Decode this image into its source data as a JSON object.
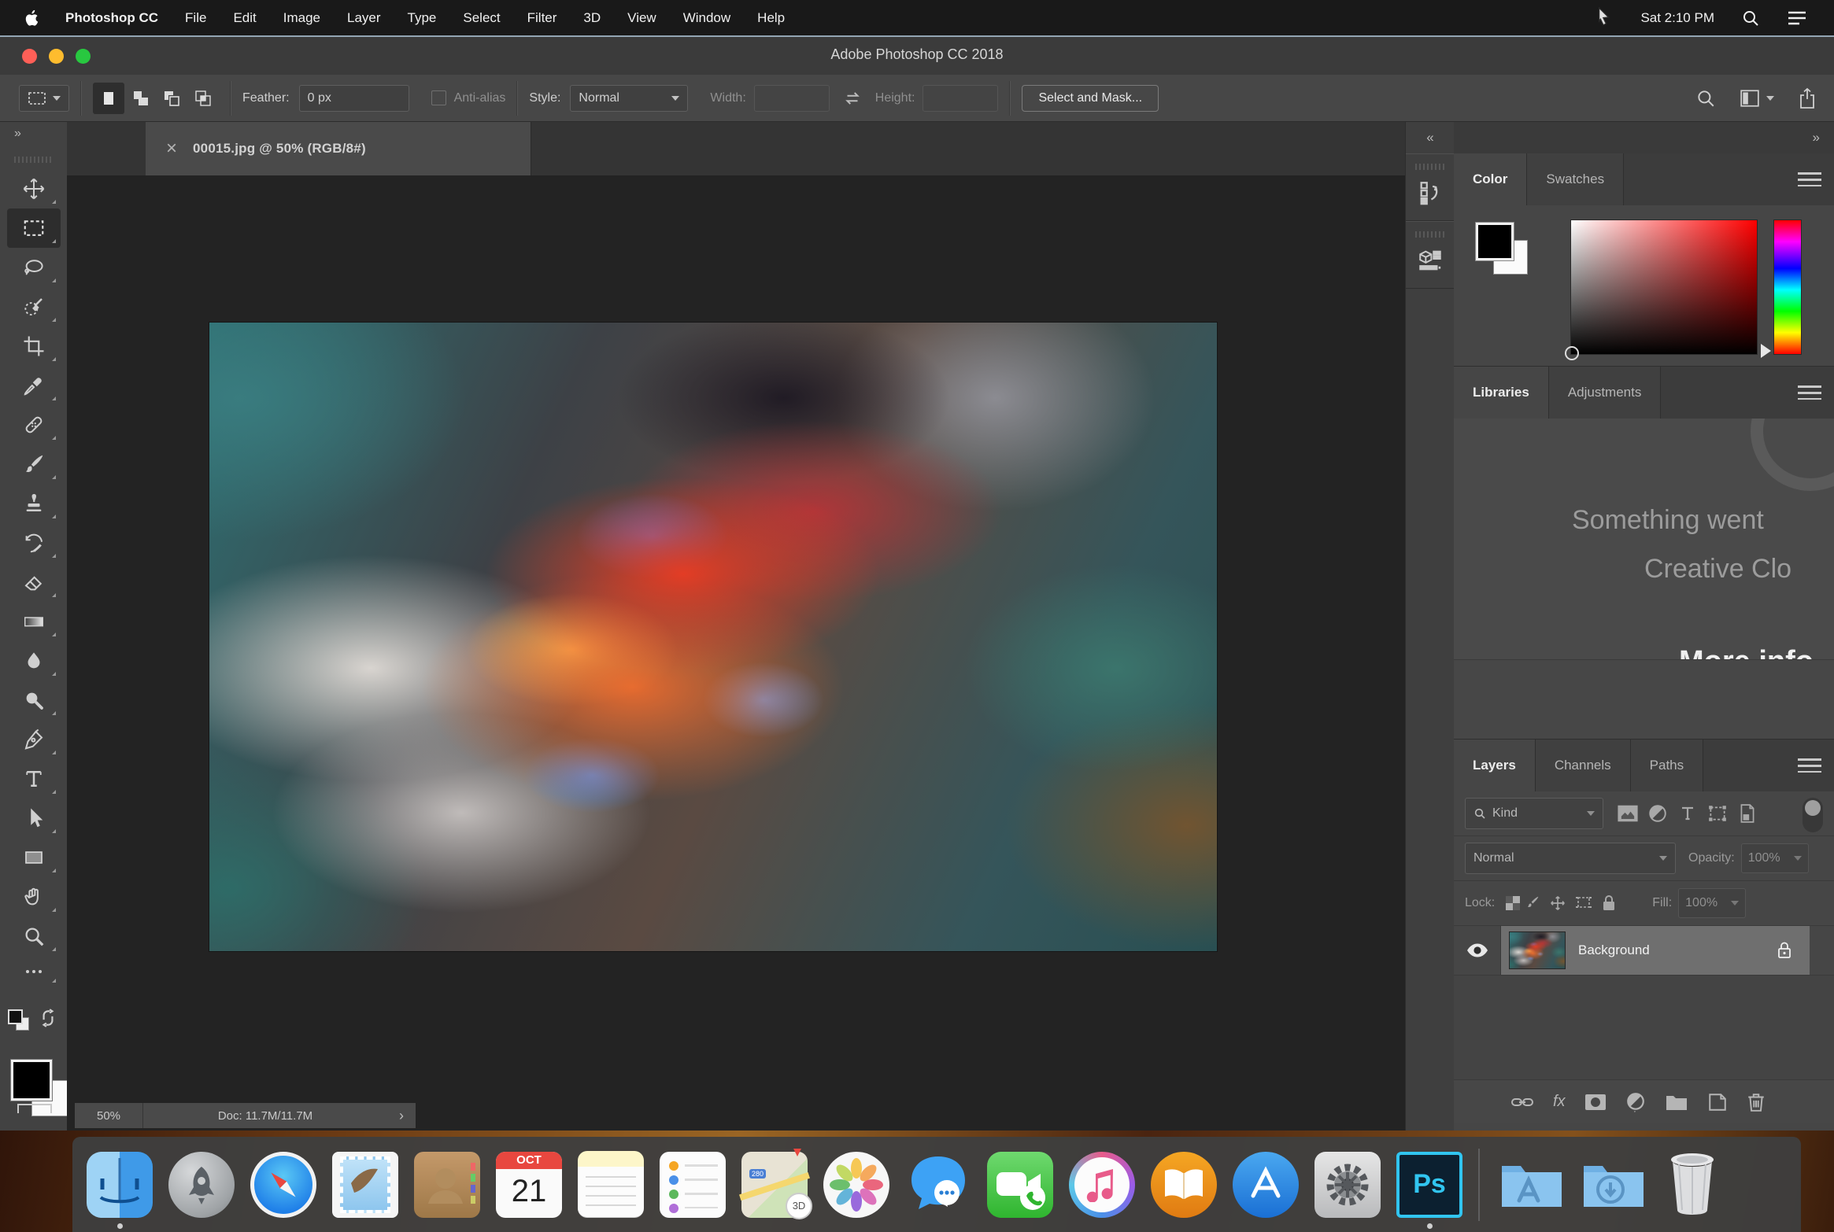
{
  "menubar": {
    "apple_icon": "apple-logo",
    "items": [
      "Photoshop CC",
      "File",
      "Edit",
      "Image",
      "Layer",
      "Type",
      "Select",
      "Filter",
      "3D",
      "View",
      "Window",
      "Help"
    ],
    "clock": "Sat 2:10 PM",
    "right_icons": [
      "pointer-cursor",
      "spotlight-search-icon",
      "menu-list-icon"
    ]
  },
  "window": {
    "title": "Adobe Photoshop CC 2018"
  },
  "options_bar": {
    "tool_preset": "rectangular-marquee",
    "modes": [
      "new-selection",
      "add-to-selection",
      "subtract-from-selection",
      "intersect-selection"
    ],
    "feather_label": "Feather:",
    "feather_value": "0 px",
    "anti_alias_label": "Anti-alias",
    "style_label": "Style:",
    "style_value": "Normal",
    "width_label": "Width:",
    "width_value": "",
    "swap_icon": "swap-width-height",
    "height_label": "Height:",
    "height_value": "",
    "select_and_mask_label": "Select and Mask..."
  },
  "document": {
    "tab_title": "00015.jpg @ 50% (RGB/8#)",
    "close_glyph": "×",
    "zoom_level": "50%",
    "doc_size": "Doc: 11.7M/11.7M",
    "status_chevron": "›"
  },
  "glyphs": {
    "expand": "»",
    "collapse": "«"
  },
  "tools": [
    "move",
    "rectangular-marquee",
    "lasso",
    "quick-selection",
    "crop",
    "eyedropper",
    "spot-healing-brush",
    "brush",
    "clone-stamp",
    "history-brush",
    "eraser",
    "gradient",
    "blur",
    "dodge",
    "pen",
    "type",
    "path-selection",
    "rectangle",
    "hand",
    "zoom"
  ],
  "active_tool": "rectangular-marquee",
  "foreground_color": "#000000",
  "background_color": "#ffffff",
  "collapsed_panels": [
    "history",
    "3d"
  ],
  "color_panel": {
    "tabs": [
      "Color",
      "Swatches"
    ],
    "active_tab": "Color",
    "hue": "red"
  },
  "libraries_panel": {
    "tabs": [
      "Libraries",
      "Adjustments"
    ],
    "active_tab": "Libraries",
    "message_line1": "Something went",
    "message_line2": "Creative Clo",
    "link_label": "More info"
  },
  "layers_panel": {
    "tabs": [
      "Layers",
      "Channels",
      "Paths"
    ],
    "active_tab": "Layers",
    "filter_label": "Kind",
    "filter_icons": [
      "pixel-layer-filter",
      "adjustment-layer-filter",
      "type-layer-filter",
      "shape-layer-filter",
      "smart-object-filter"
    ],
    "blend_mode": "Normal",
    "opacity_label": "Opacity:",
    "opacity_value": "100%",
    "lock_label": "Lock:",
    "lock_icons": [
      "lock-transparent-pixels",
      "lock-image-pixels",
      "lock-position",
      "lock-artboard",
      "lock-all"
    ],
    "fill_label": "Fill:",
    "fill_value": "100%",
    "layers": [
      {
        "name": "Background",
        "visible": true,
        "locked": true
      }
    ],
    "fx_label": "fx",
    "action_icons": [
      "link-layers",
      "layer-style-fx",
      "add-layer-mask",
      "new-adjustment-layer",
      "new-group-folder",
      "new-layer",
      "delete-layer-trash"
    ]
  },
  "dock": {
    "apps": [
      "finder",
      "launchpad",
      "safari",
      "mail",
      "contacts",
      "calendar",
      "notes",
      "reminders",
      "maps",
      "photos",
      "messages",
      "facetime",
      "itunes",
      "ibooks",
      "app-store",
      "system-preferences",
      "photoshop",
      "applications-folder",
      "downloads-folder",
      "trash"
    ],
    "running": [
      "finder",
      "photoshop"
    ],
    "calendar_month": "OCT",
    "calendar_day": "21",
    "maps_shield": "280",
    "maps_badge": "3D",
    "photoshop_label": "Ps"
  },
  "colors": {
    "accent_cyan": "#31c5f0",
    "traffic_red": "#ff5f57",
    "traffic_yellow": "#febc2e",
    "traffic_green": "#28c840",
    "panel_bg": "#464646",
    "canvas_bg": "#232323"
  }
}
